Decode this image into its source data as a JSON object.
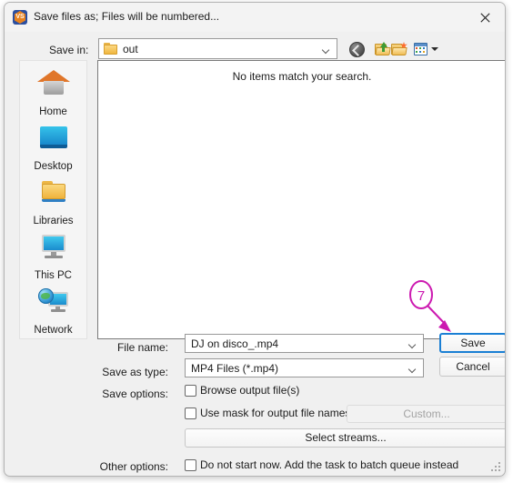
{
  "window": {
    "title": "Save files as; Files will be numbered...",
    "app_icon": "vs-logo-icon",
    "app_icon_text": "VS",
    "close_label": "✕"
  },
  "toolbar": {
    "save_in_label": "Save in:",
    "current_folder": "out",
    "buttons": [
      {
        "name": "back-button",
        "icon": "back-arrow-icon"
      },
      {
        "name": "up-one-level-button",
        "icon": "folder-up-icon"
      },
      {
        "name": "create-new-folder-button",
        "icon": "new-folder-icon"
      },
      {
        "name": "views-button",
        "icon": "views-grid-icon"
      }
    ]
  },
  "places": {
    "items": [
      {
        "label": "Home",
        "icon": "home-icon"
      },
      {
        "label": "Desktop",
        "icon": "desktop-icon"
      },
      {
        "label": "Libraries",
        "icon": "libraries-folder-icon"
      },
      {
        "label": "This PC",
        "icon": "this-pc-icon"
      },
      {
        "label": "Network",
        "icon": "network-icon"
      }
    ]
  },
  "file_list": {
    "empty_message": "No items match your search."
  },
  "form": {
    "file_name_label": "File name:",
    "file_name_value": "DJ on disco_.mp4",
    "save_as_type_label": "Save as type:",
    "save_as_type_value": "MP4 Files (*.mp4)",
    "save_options_label": "Save options:",
    "other_options_label": "Other options:",
    "checkbox_browse": "Browse output file(s)",
    "checkbox_browse_checked": false,
    "checkbox_usemask": "Use mask for output file names",
    "checkbox_usemask_checked": false,
    "checkbox_batch": "Do not start now. Add the task to batch queue instead",
    "checkbox_batch_checked": false,
    "custom_button": "Custom...",
    "custom_button_enabled": false,
    "select_streams_button": "Select streams...",
    "save_button": "Save",
    "cancel_button": "Cancel"
  },
  "annotation": {
    "step_number": "7",
    "color": "#cc19b0",
    "points_to": "save-button"
  }
}
